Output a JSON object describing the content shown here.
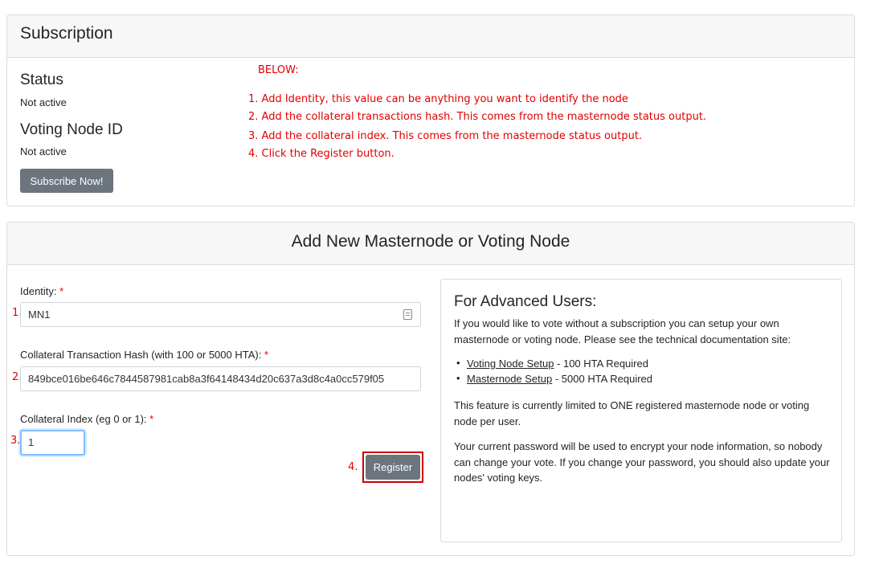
{
  "subscription": {
    "title": "Subscription",
    "status_label": "Status",
    "status_value": "Not active",
    "voting_label": "Voting Node ID",
    "voting_value": "Not active",
    "subscribe_button": "Subscribe Now!"
  },
  "instructions": {
    "header": "BELOW:",
    "steps": [
      "1. Add Identity, this value can be anything you want to identify the node",
      "2. Add the collateral transactions hash. This comes from the masternode status output.",
      "3. Add the collateral index. This comes from the masternode status output.",
      "4. Click the Register button."
    ],
    "markers": [
      "1.",
      "2.",
      "3.",
      "4."
    ]
  },
  "add_node": {
    "title": "Add New Masternode or Voting Node",
    "identity_label": "Identity:",
    "identity_value": "MN1",
    "hash_label": "Collateral Transaction Hash (with 100 or 5000 HTA):",
    "hash_value": "849bce016be646c7844587981cab8a3f64148434d20c637a3d8c4a0cc579f05",
    "index_label": "Collateral Index (eg 0 or 1):",
    "index_value": "1",
    "required_mark": "*",
    "register_button": "Register"
  },
  "advanced": {
    "title": "For Advanced Users:",
    "intro": "If you would like to vote without a subscription you can setup your own masternode or voting node. Please see the technical documentation site:",
    "links": [
      {
        "label": "Voting Node Setup",
        "suffix": " - 100 HTA Required"
      },
      {
        "label": "Masternode Setup",
        "suffix": " - 5000 HTA Required"
      }
    ],
    "limit_note": "This feature is currently limited to ONE registered masternode node or voting node per user.",
    "password_note": "Your current password will be used to encrypt your node information, so nobody can change your vote. If you change your password, you should also update your nodes' voting keys."
  },
  "colors": {
    "accent_red": "#e00000",
    "button_gray": "#6c757d",
    "focus_blue": "#80bdff"
  }
}
